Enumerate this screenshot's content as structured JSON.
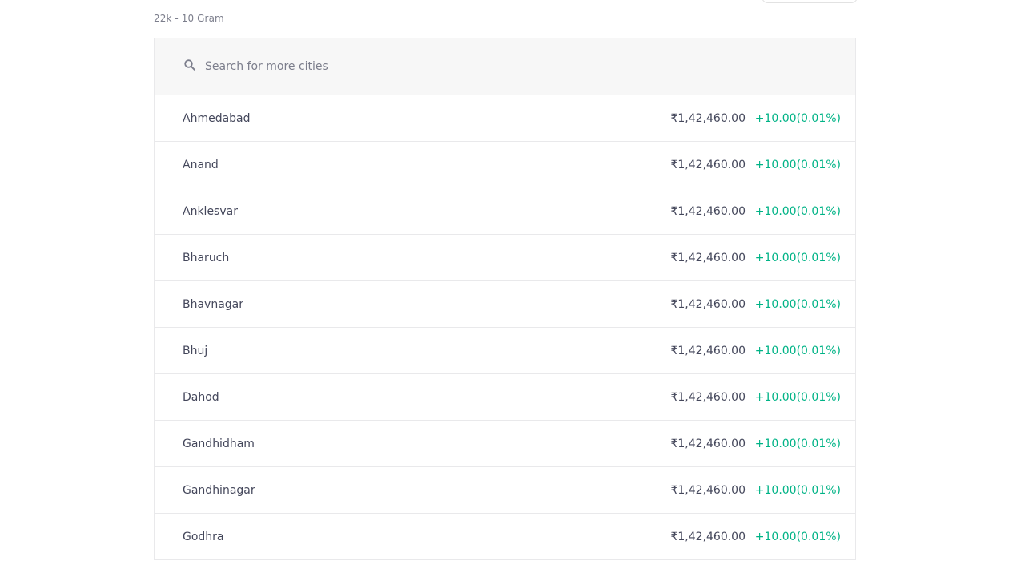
{
  "header": {
    "subtitle": "22k - 10 Gram"
  },
  "search": {
    "placeholder": "Search for more cities",
    "icon": "search-icon"
  },
  "colors": {
    "positive": "#00b386",
    "text": "#44475b",
    "muted": "#7c7e8c",
    "border": "#e9e9eb",
    "search_bg": "#f7f7f7"
  },
  "cities": [
    {
      "name": "Ahmedabad",
      "price": "₹1,42,460.00",
      "change": "+10.00(0.01%)"
    },
    {
      "name": "Anand",
      "price": "₹1,42,460.00",
      "change": "+10.00(0.01%)"
    },
    {
      "name": "Anklesvar",
      "price": "₹1,42,460.00",
      "change": "+10.00(0.01%)"
    },
    {
      "name": "Bharuch",
      "price": "₹1,42,460.00",
      "change": "+10.00(0.01%)"
    },
    {
      "name": "Bhavnagar",
      "price": "₹1,42,460.00",
      "change": "+10.00(0.01%)"
    },
    {
      "name": "Bhuj",
      "price": "₹1,42,460.00",
      "change": "+10.00(0.01%)"
    },
    {
      "name": "Dahod",
      "price": "₹1,42,460.00",
      "change": "+10.00(0.01%)"
    },
    {
      "name": "Gandhidham",
      "price": "₹1,42,460.00",
      "change": "+10.00(0.01%)"
    },
    {
      "name": "Gandhinagar",
      "price": "₹1,42,460.00",
      "change": "+10.00(0.01%)"
    },
    {
      "name": "Godhra",
      "price": "₹1,42,460.00",
      "change": "+10.00(0.01%)"
    }
  ]
}
